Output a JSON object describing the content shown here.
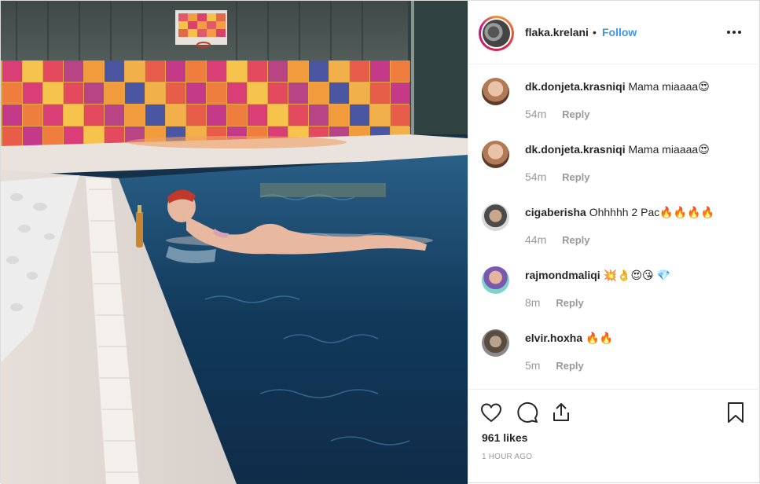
{
  "post": {
    "header": {
      "username": "flaka.krelani",
      "separator": "•",
      "follow_label": "Follow"
    },
    "comments": [
      {
        "user": "dk.donjeta.krasniqi",
        "text": "Mama miaaaa😍",
        "time": "54m",
        "reply_label": "Reply"
      },
      {
        "user": "dk.donjeta.krasniqi",
        "text": "Mama miaaaa😍",
        "time": "54m",
        "reply_label": "Reply"
      },
      {
        "user": "cigaberisha",
        "text": "Ohhhhh 2 Pac🔥🔥🔥🔥",
        "time": "44m",
        "reply_label": "Reply"
      },
      {
        "user": "rajmondmaliqi",
        "text": "💥👌😍😘 💎",
        "time": "8m",
        "reply_label": "Reply"
      },
      {
        "user": "elvir.hoxha",
        "text": "🔥🔥",
        "time": "5m",
        "reply_label": "Reply"
      }
    ],
    "actions": {
      "icons": [
        "heart-icon",
        "comment-icon",
        "share-icon",
        "bookmark-icon"
      ]
    },
    "likes": "961 likes",
    "time_ago": "1 HOUR AGO"
  },
  "colors": {
    "link_blue": "#3897f0",
    "text_dark": "#262626",
    "text_muted": "#999999",
    "border": "#efefef"
  }
}
